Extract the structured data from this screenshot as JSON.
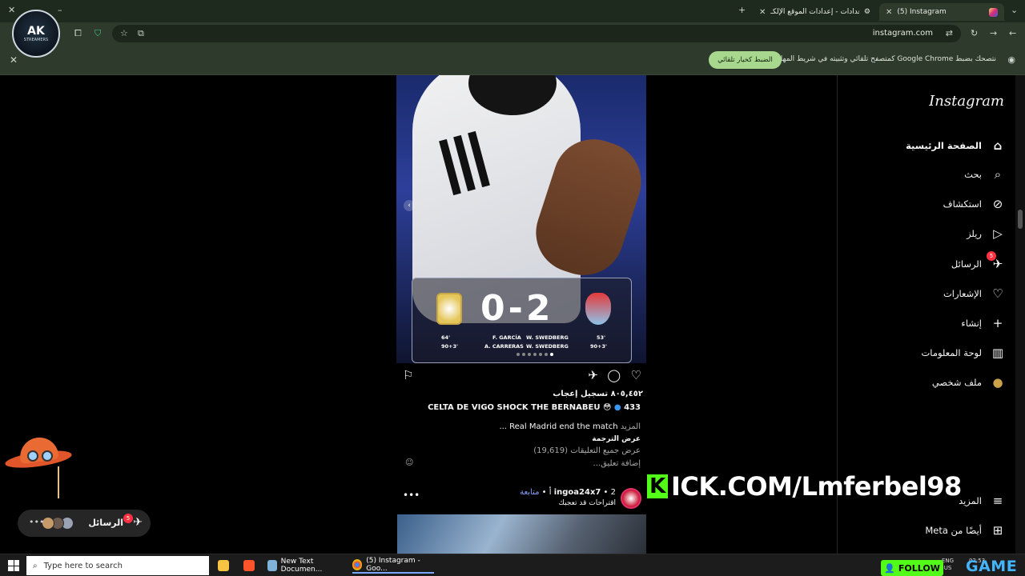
{
  "browser": {
    "tabs": [
      {
        "label": "(5) Instagram",
        "active": true
      },
      {
        "label": "الإعدادات - إعدادات الموقع الإلكـ",
        "active": false
      }
    ],
    "url": "instagram.com",
    "infobar": {
      "text": "نتصحك بضبط Google Chrome كمتصفح تلقائي وتثبيته في شريط المهام",
      "button": "الضبط كخيار تلقائي"
    }
  },
  "overlay_logo": {
    "main": "AK",
    "sub": "STREAMERS"
  },
  "sidebar": {
    "logo": "Instagram",
    "items": [
      {
        "label": "الصفحة الرئيسية",
        "icon": "home-icon",
        "glyph": "⌂"
      },
      {
        "label": "بحث",
        "icon": "search-icon",
        "glyph": "⌕"
      },
      {
        "label": "استكشاف",
        "icon": "compass-icon",
        "glyph": "⊘"
      },
      {
        "label": "ريلز",
        "icon": "reels-icon",
        "glyph": "▷"
      },
      {
        "label": "الرسائل",
        "icon": "messenger-icon",
        "glyph": "✈",
        "badge": "5"
      },
      {
        "label": "الإشعارات",
        "icon": "heart-icon",
        "glyph": "♡"
      },
      {
        "label": "إنشاء",
        "icon": "plus-icon",
        "glyph": "+"
      },
      {
        "label": "لوحة المعلومات",
        "icon": "dashboard-icon",
        "glyph": "▥"
      },
      {
        "label": "ملف شخصي",
        "icon": "profile-avatar-icon",
        "glyph": "●"
      },
      {
        "label": "المزيد",
        "icon": "menu-icon",
        "glyph": "≡"
      },
      {
        "label": "أيضًا من Meta",
        "icon": "meta-apps-icon",
        "glyph": "⊞"
      }
    ]
  },
  "post": {
    "scoreboard": {
      "score": "0-2",
      "scorers_right": [
        "W. SWEDBERG",
        "W. SWEDBERG"
      ],
      "minutes_right": [
        "53'",
        "90+3'"
      ],
      "scorers_left": [
        "F. GARCÍA",
        "A. CARRERAS"
      ],
      "minutes_left": [
        "64'",
        "90+3'"
      ]
    },
    "likes": "٨٠٥,٤٥٢ تسجيل إعجاب",
    "caption_user": "433",
    "caption_title": "CELTA DE VIGO SHOCK THE BERNABEU",
    "caption_text": "Real Madrid end the match ...",
    "caption_more": "المزيد",
    "see_translation": "عرض الترجمة",
    "view_all_comments": "عرض جميع التعليقات (19,619)",
    "add_comment": "إضافة تعليق..."
  },
  "post2": {
    "username": "ingoa24x7",
    "meta": "• 2 أ •",
    "follow": "متابعة",
    "subtitle": "اقتراحات قد تعجبك"
  },
  "stream_overlay": {
    "kick_rest": "ICK.COM/Lmferbel98",
    "follow": "FOLLOW",
    "game": "GAME"
  },
  "messages_pill": {
    "label": "الرسائل",
    "badge": "5",
    "dots": "•••"
  },
  "taskbar": {
    "search_placeholder": "Type here to search",
    "apps": [
      {
        "label": "New Text Documen..."
      },
      {
        "label": "(5) Instagram - Goo..."
      }
    ],
    "lang": "ENG",
    "region": "US",
    "time": "02:53"
  }
}
